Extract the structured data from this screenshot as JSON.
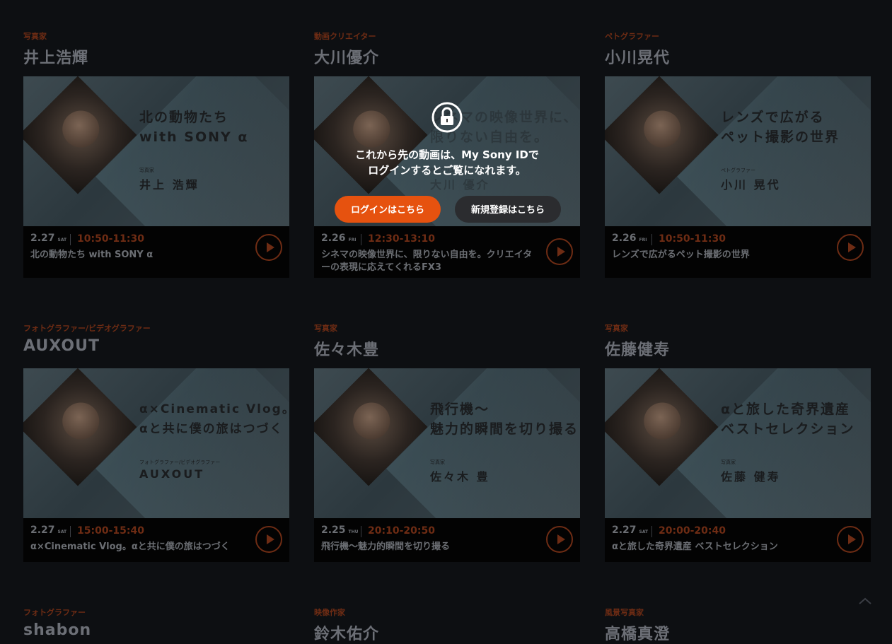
{
  "cards": [
    {
      "role": "写真家",
      "name": "井上浩輝",
      "thumb_title_1": "北の動物たち",
      "thumb_title_2": "with SONY α",
      "thumb_role": "写真家",
      "thumb_name": "井上 浩輝",
      "date": "2.27",
      "day": "SAT",
      "time": "10:50-11:30",
      "desc": "北の動物たち with SONY α"
    },
    {
      "role": "動画クリエイター",
      "name": "大川優介",
      "thumb_title_1": "シネマの映像世界に、",
      "thumb_title_2": "限りない自由を。",
      "thumb_role": "動画クリエイター",
      "thumb_name": "大川 優介",
      "date": "2.26",
      "day": "FRI",
      "time": "12:30-13:10",
      "desc": "シネマの映像世界に、限りない自由を。クリエイターの表現に応えてくれるFX3"
    },
    {
      "role": "ペトグラファー",
      "name": "小川晃代",
      "thumb_title_1": "レンズで広がる",
      "thumb_title_2": "ペット撮影の世界",
      "thumb_role": "ペトグラファー",
      "thumb_name": "小川 晃代",
      "date": "2.26",
      "day": "FRI",
      "time": "10:50-11:30",
      "desc": "レンズで広がるペット撮影の世界"
    },
    {
      "role": "フォトグラファー/ビデオグラファー",
      "name": "AUXOUT",
      "thumb_title_1": "α×Cinematic Vlog。",
      "thumb_title_2": "αと共に僕の旅はつづく",
      "thumb_role": "フォトグラファー/ビデオグラファー",
      "thumb_name": "AUXOUT",
      "date": "2.27",
      "day": "SAT",
      "time": "15:00-15:40",
      "desc": "α×Cinematic Vlog。αと共に僕の旅はつづく"
    },
    {
      "role": "写真家",
      "name": "佐々木豊",
      "thumb_title_1": "飛行機～",
      "thumb_title_2": "魅力的瞬間を切り撮る",
      "thumb_role": "写真家",
      "thumb_name": "佐々木 豊",
      "date": "2.25",
      "day": "THU",
      "time": "20:10-20:50",
      "desc": "飛行機～魅力的瞬間を切り撮る"
    },
    {
      "role": "写真家",
      "name": "佐藤健寿",
      "thumb_title_1": "αと旅した奇界遺産",
      "thumb_title_2": "ベストセレクション",
      "thumb_role": "写真家",
      "thumb_name": "佐藤 健寿",
      "date": "2.27",
      "day": "SAT",
      "time": "20:00-20:40",
      "desc": "αと旅した奇界遺産 ベストセレクション"
    },
    {
      "role": "フォトグラファー",
      "name": "shabon"
    },
    {
      "role": "映像作家",
      "name": "鈴木佑介"
    },
    {
      "role": "風景写真家",
      "name": "高橋真澄"
    }
  ],
  "overlay": {
    "message_1": "これから先の動画は、My Sony IDで",
    "message_2": "ログインするとご覧になれます。",
    "login_label": "ログインはこちら",
    "register_label": "新規登録はこちら"
  },
  "colors": {
    "accent": "#e6520f",
    "background": "#0d0f12",
    "role_text": "#6e2c14"
  },
  "icons": {
    "lock": "lock-icon",
    "play": "play-icon",
    "scroll_top": "chevron-up-icon"
  }
}
